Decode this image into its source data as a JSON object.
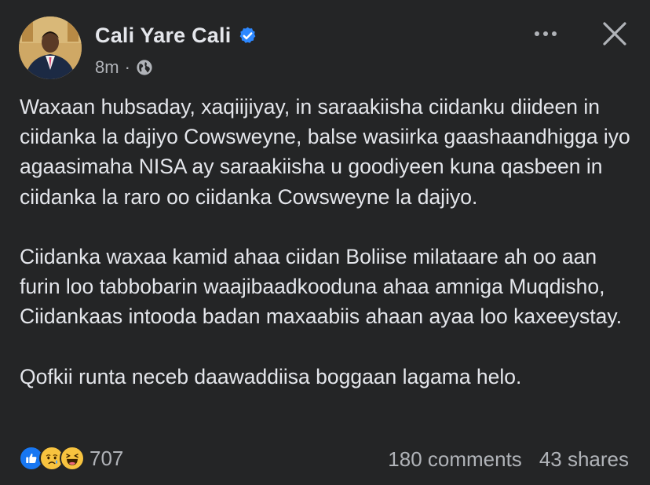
{
  "post": {
    "author": "Cali Yare Cali",
    "verified": true,
    "time": "8m",
    "separator": "·",
    "audience_icon": "globe-icon",
    "paragraphs": [
      "Waxaan hubsaday, xaqiijiyay, in saraakiisha ciidanku diideen in ciidanka la dajiyo Cowsweyne, balse wasiirka gaashaandhigga iyo agaasimaha NISA ay saraakiisha u goodiyeen kuna qasbeen in ciidanka la raro oo ciidanka Cowsweyne la dajiyo.",
      "Ciidanka waxaa kamid ahaa ciidan Boliise milataare ah oo aan furin loo tabbobarin waajibaadkooduna ahaa amniga Muqdisho, Ciidankaas intooda badan maxaabiis ahaan ayaa loo kaxeeystay.",
      "Qofkii runta neceb daawaddiisa boggaan lagama helo."
    ]
  },
  "actions": {
    "more_icon": "more-horizontal-icon",
    "close_icon": "close-icon"
  },
  "footer": {
    "reaction_icons": [
      "like-icon",
      "sad-icon",
      "haha-icon"
    ],
    "reaction_count": "707",
    "comments": "180 comments",
    "shares": "43 shares"
  },
  "colors": {
    "background": "#242526",
    "primary_text": "#e4e6eb",
    "secondary_text": "#b0b3b8",
    "verified_blue": "#2d88ff",
    "like_blue": "#1877f2",
    "emoji_yellow": "#f7c33f"
  }
}
